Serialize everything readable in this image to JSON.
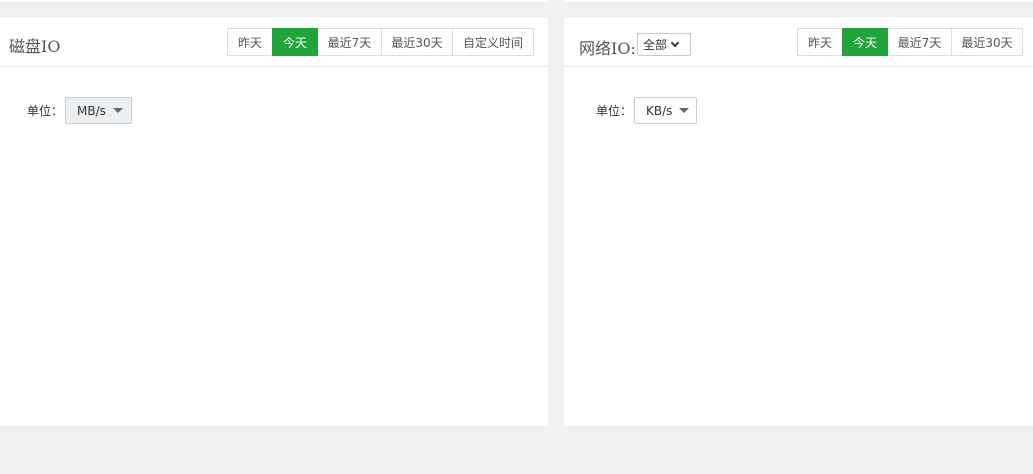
{
  "disk_panel": {
    "title": "磁盘IO",
    "time_buttons": [
      "昨天",
      "今天",
      "最近7天",
      "最近30天",
      "自定义时间"
    ],
    "active_button": "今天",
    "unit_label": "单位：",
    "unit_value": "MB/s"
  },
  "network_panel": {
    "title": "网络IO:",
    "interface_select": "全部",
    "time_buttons": [
      "昨天",
      "今天",
      "最近7天",
      "最近30天"
    ],
    "active_button": "今天",
    "unit_label": "单位：",
    "unit_value": "KB/s"
  },
  "colors": {
    "accent": "#20a53a",
    "page_background": "#f0f0f0",
    "panel_background": "#ffffff"
  }
}
